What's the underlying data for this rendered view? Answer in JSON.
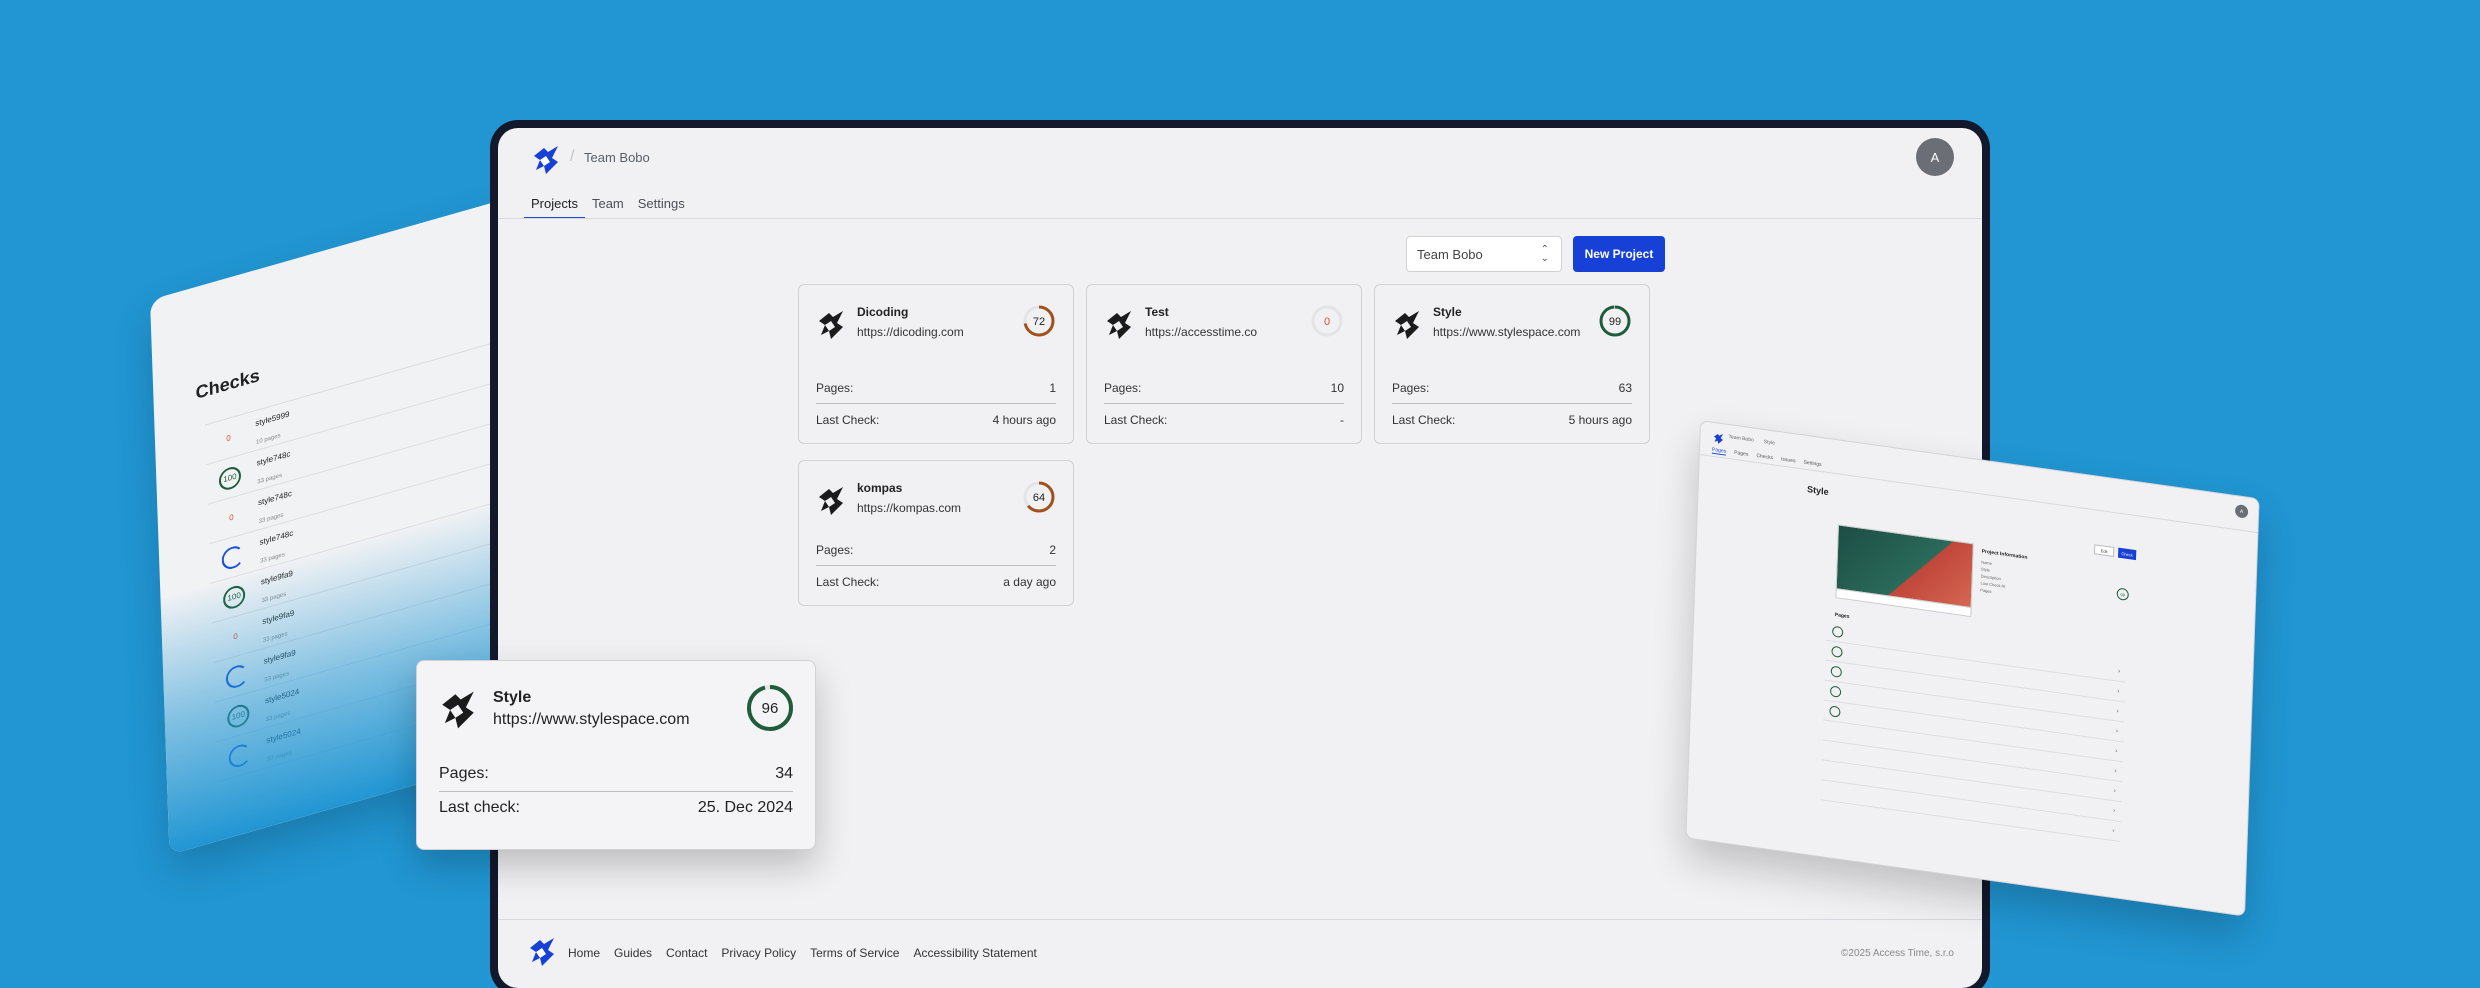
{
  "checks_card": {
    "title": "Checks",
    "rows": [
      {
        "score": "0",
        "kind": "red",
        "name": "style5999",
        "pages": "10 pages"
      },
      {
        "score": "100",
        "kind": "green",
        "name": "style748c",
        "pages": "33 pages"
      },
      {
        "score": "0",
        "kind": "red",
        "name": "style748c",
        "pages": "33 pages"
      },
      {
        "score": "",
        "kind": "spin",
        "name": "style748c",
        "pages": "33 pages"
      },
      {
        "score": "100",
        "kind": "green",
        "name": "style9fa9",
        "pages": "33 pages"
      },
      {
        "score": "0",
        "kind": "red",
        "name": "style9fa9",
        "pages": "33 pages"
      },
      {
        "score": "",
        "kind": "spin",
        "name": "style9fa9",
        "pages": "33 pages"
      },
      {
        "score": "100",
        "kind": "green",
        "name": "style5024",
        "pages": "33 pages"
      },
      {
        "score": "",
        "kind": "spin",
        "name": "style5024",
        "pages": "33 pages"
      }
    ]
  },
  "app": {
    "breadcrumb": "Team Bobo",
    "avatar_initial": "A",
    "tabs": [
      "Projects",
      "Team",
      "Settings"
    ],
    "team_select": "Team Bobo",
    "new_project_label": "New Project",
    "pages_label": "Pages:",
    "last_check_label": "Last Check:",
    "projects": [
      {
        "name": "Dicoding",
        "url": "https://dicoding.com",
        "score": 72,
        "score_color": "#a0521d",
        "pages": "1",
        "last_check": "4 hours ago"
      },
      {
        "name": "Test",
        "url": "https://accesstime.co",
        "score": 0,
        "score_color": "#e24a2d",
        "pages": "10",
        "last_check": "-"
      },
      {
        "name": "Style",
        "url": "https://www.stylespace.com",
        "score": 99,
        "score_color": "#1f5d3a",
        "pages": "63",
        "last_check": "5 hours ago"
      },
      {
        "name": "kompas",
        "url": "https://kompas.com",
        "score": 64,
        "score_color": "#a0521d",
        "pages": "2",
        "last_check": "a day ago"
      }
    ],
    "footer_links": [
      "Home",
      "Guides",
      "Contact",
      "Privacy Policy",
      "Terms of Service",
      "Accessibility Statement"
    ],
    "copyright": "©2025 Access Time, s.r.o"
  },
  "float_card": {
    "name": "Style",
    "url": "https://www.stylespace.com",
    "score": 96,
    "score_color": "#1f5d3a",
    "pages_label": "Pages:",
    "pages": "34",
    "last_check_label": "Last check:",
    "last_check": "25. Dec 2024"
  },
  "mini_screen": {
    "crumbs": [
      "Team Bobo",
      "Style"
    ],
    "avatar_initial": "A",
    "tabs": [
      "Pages",
      "Pages",
      "Checks",
      "Issues",
      "Settings"
    ],
    "title": "Style",
    "btn_edit": "Edit",
    "btn_check": "Check",
    "info_title": "Project Information",
    "info_lines": [
      "Name",
      "Style",
      "Description",
      "Last Check At",
      "Pages"
    ],
    "score": "99",
    "pages_title": "Pages",
    "page_rows": 9
  },
  "colors": {
    "background": "#2196d3",
    "accent": "#1640d6",
    "score_good": "#1f5d3a",
    "score_mid": "#a0521d",
    "score_bad": "#e24a2d"
  }
}
